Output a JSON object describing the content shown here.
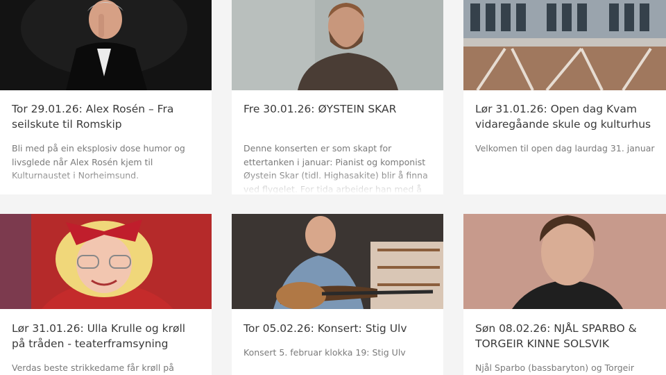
{
  "events": [
    {
      "title": "Tor 29.01.26: Alex Rosén – Fra seilskute til Romskip",
      "description": "Bli med på ein eksplosiv dose humor og livsglede når Alex Rosén kjem til Kulturnaustet i Norheimsund."
    },
    {
      "title": "Fre 30.01.26: ØYSTEIN SKAR",
      "description": "Denne konserten er som skapt for ettertanken i januar: Pianist og komponist Øystein Skar (tidl. Highasakite) blir å finna ved flygelet. For tida arbeider han med å utvikla nye soloverk som utforskar samspelet mellom akustiske og"
    },
    {
      "title": "Lør 31.01.26: Open dag Kvam vidaregåande skule og kulturhus",
      "description": "Velkomen til open dag laurdag 31. januar"
    },
    {
      "title": "Lør 31.01.26: Ulla Krulle og krøll på tråden - teaterframsyning",
      "description": "Verdas beste strikkedame får krøll på tråden!"
    },
    {
      "title": "Tor 05.02.26: Konsert: Stig Ulv",
      "description": "Konsert 5. februar klokka 19: Stig Ulv"
    },
    {
      "title": "Søn 08.02.26: NJÅL SPARBO & TORGEIR KINNE SOLSVIK",
      "description": "Njål Sparbo (bassbaryton) og Torgeir Kinne"
    }
  ]
}
